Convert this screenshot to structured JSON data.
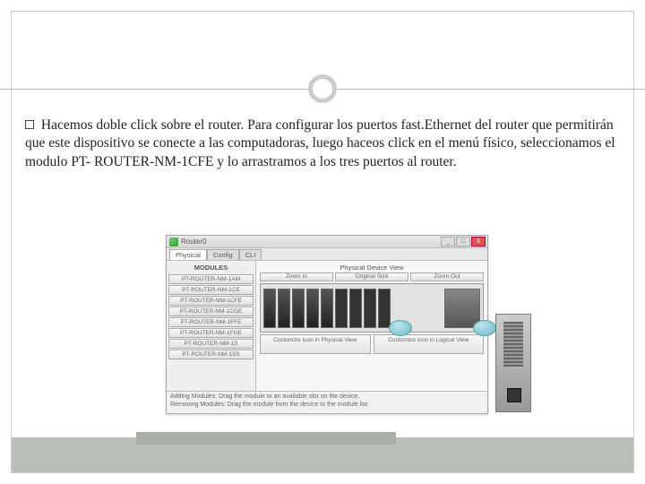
{
  "bullet": {
    "text": "Hacemos doble click sobre el router. Para configurar los puertos fast.Ethernet del router que permitirán que este dispositivo se conecte a las computadoras, luego haceos click en el menú físico, seleccionamos el modulo PT- ROUTER-NM-1CFE y lo arrastramos a los tres puertos al router."
  },
  "window": {
    "title": "Router0",
    "tabs": {
      "physical": "Physical",
      "config": "Config",
      "cli": "CLI"
    },
    "modules_header": "MODULES",
    "modules": [
      "PT-ROUTER-NM-1AM",
      "PT-ROUTER-NM-1CE",
      "PT-ROUTER-NM-1CFE",
      "PT-ROUTER-NM-1CGE",
      "PT-ROUTER-NM-1FFE",
      "PT-ROUTER-NM-1FGE",
      "PT-ROUTER-NM-1S",
      "PT-ROUTER-NM-1SS"
    ],
    "phys_view_label": "Physical Device View",
    "zoom": {
      "in": "Zoom In",
      "orig": "Original Size",
      "out": "Zoom Out"
    },
    "customize": {
      "phys": "Customize Icon in Physical View",
      "logic": "Customize Icon in Logical View"
    },
    "hint_line1": "Adding Modules: Drag the module to an available slot on the device.",
    "hint_line2": "Removing Modules: Drag the module from the device to the module list.",
    "btn": {
      "min": "_",
      "max": "□",
      "close": "X"
    }
  }
}
